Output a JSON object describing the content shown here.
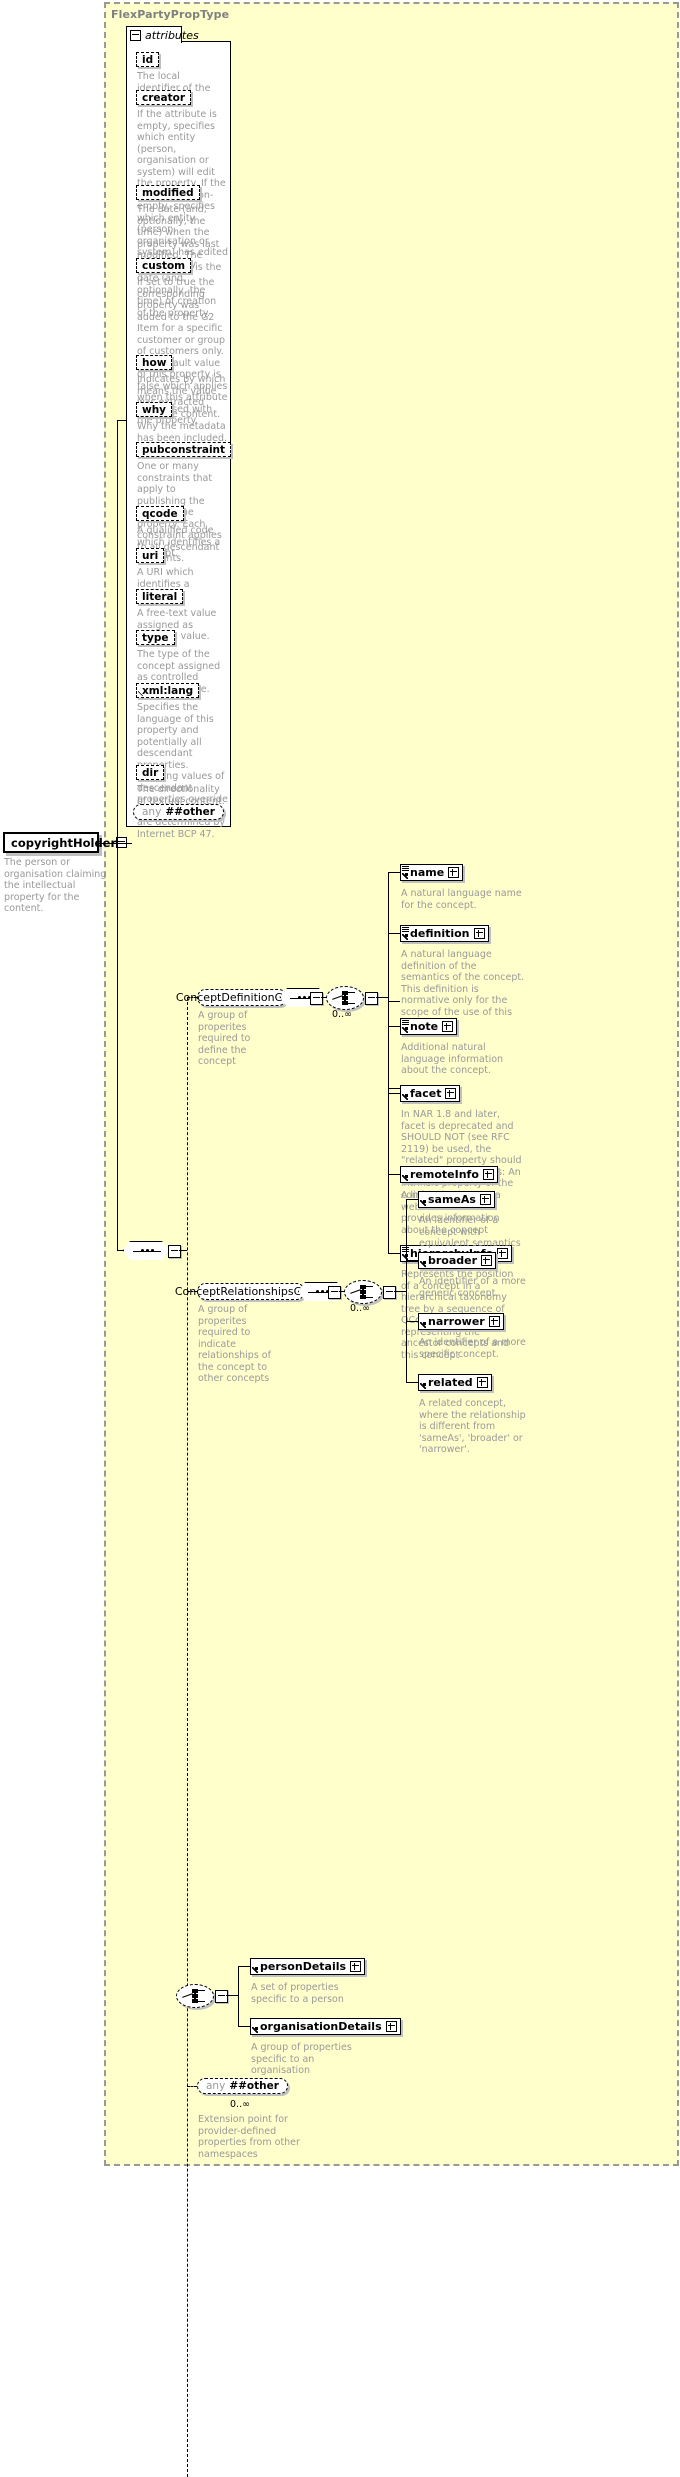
{
  "type_container": {
    "title": "FlexPartyPropType"
  },
  "attributes_panel": {
    "tab_label": "attributes"
  },
  "attributes": [
    {
      "name": "id",
      "doc": "The local identifier of the property."
    },
    {
      "name": "creator",
      "doc": "If the attribute is empty, specifies which entity (person, organisation or system) will edit the property. If the attribute is non-empty, specifies which entity (person, organisation or system) has edited the property."
    },
    {
      "name": "modified",
      "doc": "The date (and, optionally, the time) when the property was last modified. The initial value is the date (and, optionally, the time) of creation of the property."
    },
    {
      "name": "custom",
      "doc": "If set to true the corresponding property was added to the G2 Item for a specific customer or group of customers only. The default value of this property is false which applies when this attribute is not used with the property."
    },
    {
      "name": "how",
      "doc": "Indicates by which means the value was extracted from the content."
    },
    {
      "name": "why",
      "doc": "Why the metadata has been included."
    },
    {
      "name": "pubconstraint",
      "doc": "One or many constraints that apply to publishing the value of the property. Each constraint applies to all descendant elements."
    },
    {
      "name": "qcode",
      "doc": "A qualified code which identifies a concept."
    },
    {
      "name": "uri",
      "doc": "A URI which identifies a concept."
    },
    {
      "name": "literal",
      "doc": "A free-text value assigned as property value."
    },
    {
      "name": "type",
      "doc": "The type of the concept assigned as controlled property value."
    },
    {
      "name": "xml:lang",
      "doc": "Specifies the language of this property and potentially all descendant properties. xml:lang values of descendant properties override this value. Values are determined by Internet BCP 47."
    },
    {
      "name": "dir",
      "doc": "The directionality of textual content."
    }
  ],
  "attribute_any": {
    "any_label": "any",
    "ns_label": "##other"
  },
  "root_element": {
    "name": "copyrightHolder",
    "doc": "The person or organisation claiming the intellectual property for the content."
  },
  "groups": [
    {
      "name": "ConceptDefinitionGroup",
      "doc": "A group of properites required to define the concept",
      "occurs": "0..∞",
      "children": [
        {
          "name": "name",
          "doc": "A natural language name for the concept."
        },
        {
          "name": "definition",
          "doc": "A natural language definition of the semantics of the concept. This definition is normative only for the scope of the use of this concept."
        },
        {
          "name": "note",
          "doc": "Additional natural language information about the concept."
        },
        {
          "name": "facet",
          "doc": "In NAR 1.8 and later, facet is deprecated and SHOULD NOT (see RFC 2119) be used, the \"related\" property should be used instead (was: An intrinsic property of the concept.)"
        },
        {
          "name": "remoteInfo",
          "doc": "A link to an item or a web resource which provides information about the concept"
        },
        {
          "name": "hierarchyInfo",
          "doc": "Represents the position of a concept in a hierarchical taxonomy tree by a sequence of QCode tokens representing the ancestor concepts and this concept"
        }
      ]
    },
    {
      "name": "ConceptRelationshipsGroup",
      "doc": "A group of properites required to indicate relationships of the concept to other concepts",
      "occurs": "0..∞",
      "children": [
        {
          "name": "sameAs",
          "doc": "An identifier of a concept with equivalent semantics"
        },
        {
          "name": "broader",
          "doc": "An identifier of a more generic concept."
        },
        {
          "name": "narrower",
          "doc": "An identifier of a more specific concept."
        },
        {
          "name": "related",
          "doc": "A related concept, where the relationship is different from 'sameAs', 'broader' or 'narrower'."
        }
      ]
    }
  ],
  "details_choice": {
    "children": [
      {
        "name": "personDetails",
        "doc": "A set of properties specific to a person"
      },
      {
        "name": "organisationDetails",
        "doc": "A group of properties specific to an organisation"
      }
    ]
  },
  "content_any": {
    "any_label": "any",
    "ns_label": "##other",
    "occurs": "0..∞",
    "doc": "Extension point for provider-defined properties from other namespaces"
  },
  "colors": {
    "type_background": "#ffffcc",
    "type_border": "#999999",
    "doc_text": "#999999",
    "box_shadow": "#c0c0c0",
    "line": "#000000"
  }
}
